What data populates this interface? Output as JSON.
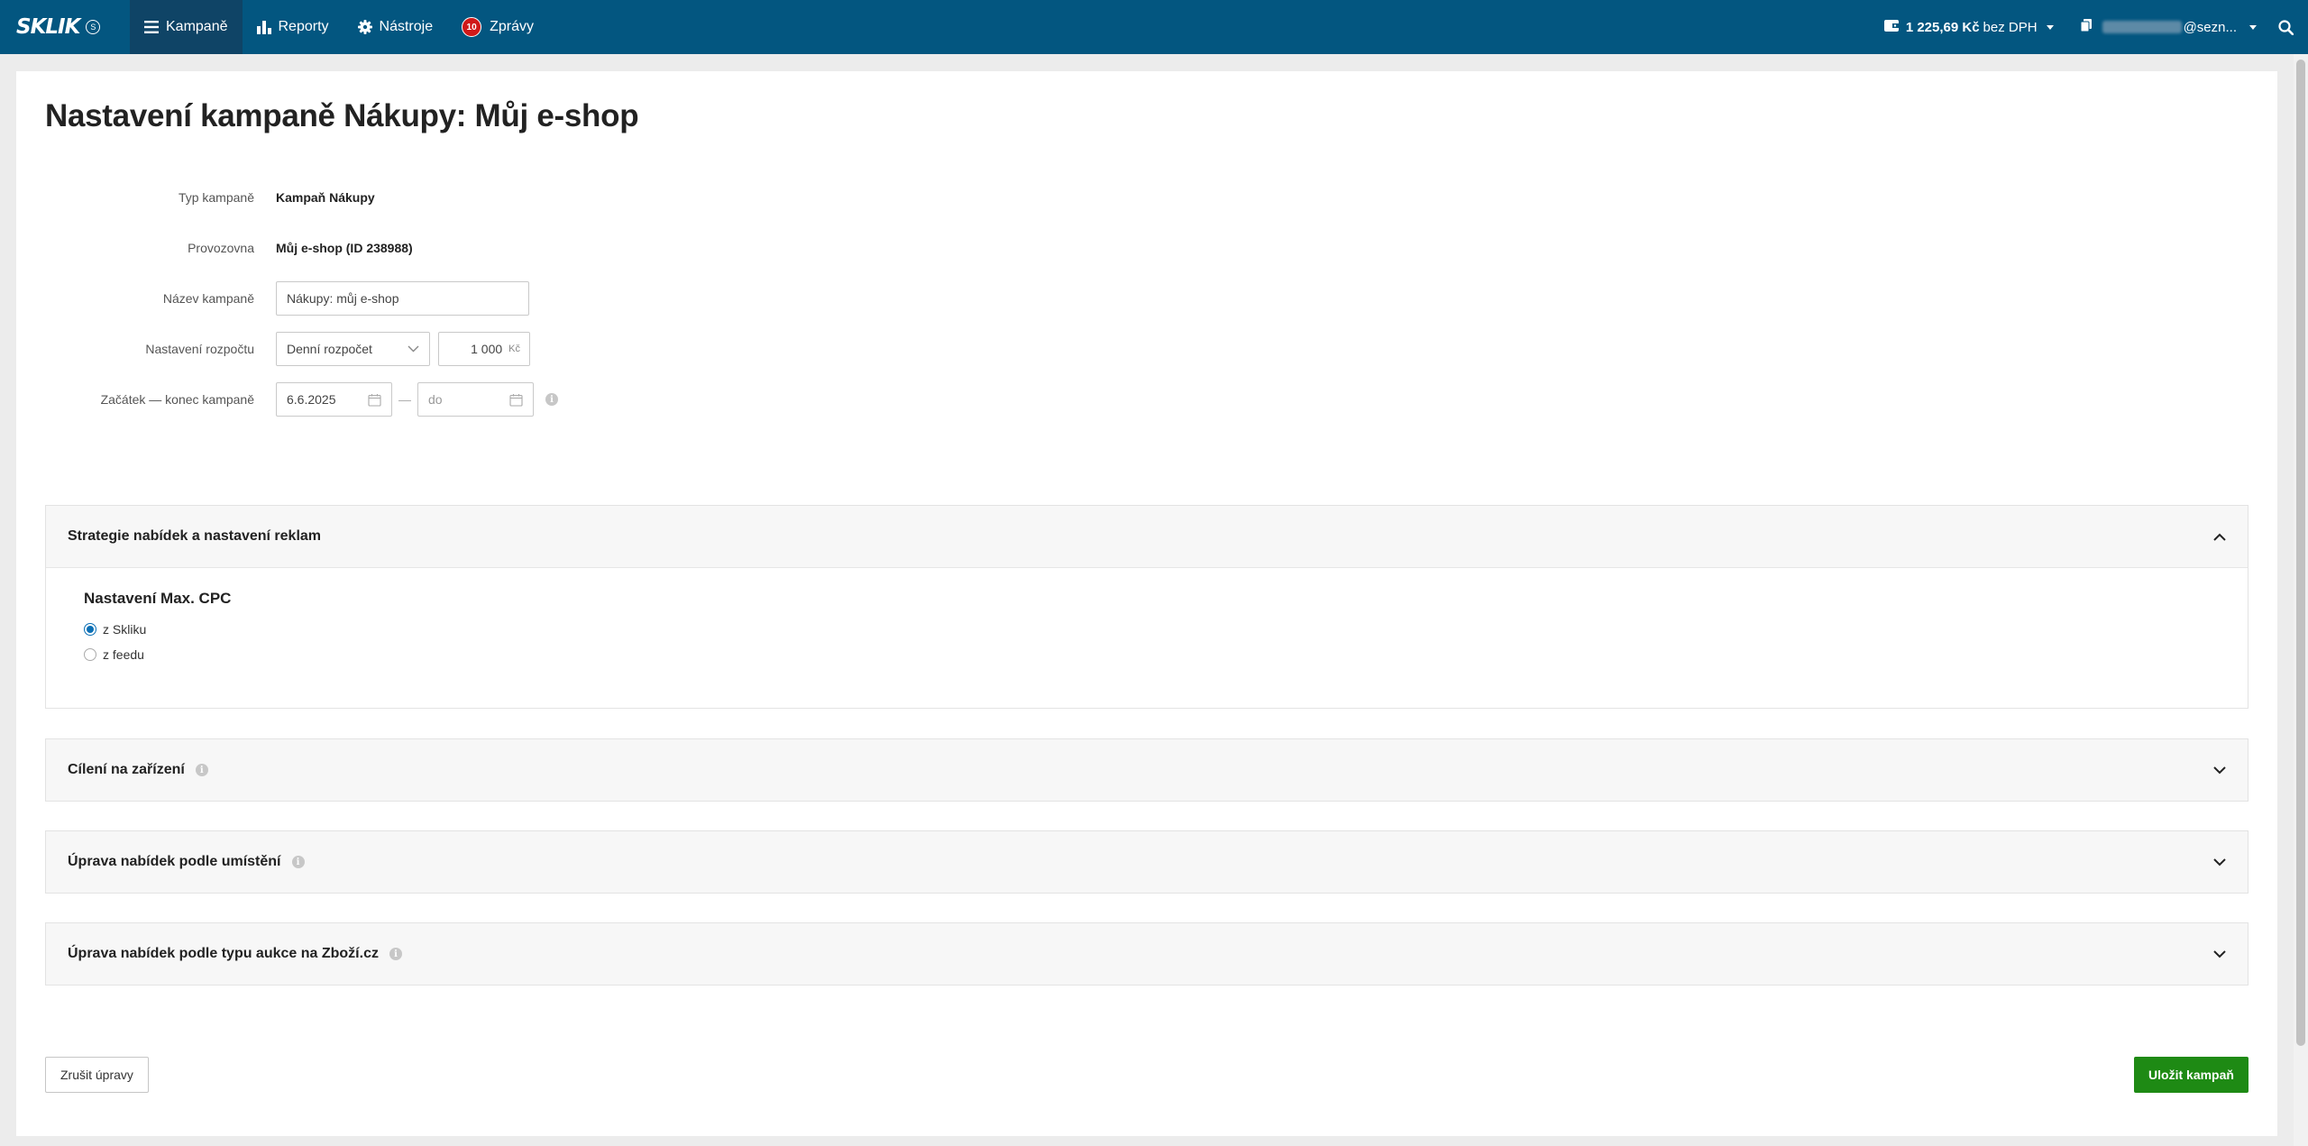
{
  "nav": {
    "logo": "SKLIK",
    "logo_badge": "S",
    "items": [
      {
        "label": "Kampaně",
        "icon": "menu-icon"
      },
      {
        "label": "Reporty",
        "icon": "bar-chart-icon"
      },
      {
        "label": "Nástroje",
        "icon": "gear-icon"
      },
      {
        "label": "Zprávy",
        "icon": "messages-badge",
        "badge": "10"
      }
    ],
    "credit_amount": "1 225,69 Kč",
    "credit_suffix": "bez DPH",
    "account_email": "@sezn...",
    "search_icon": "search-icon"
  },
  "page": {
    "title": "Nastavení kampaně Nákupy: Můj e-shop"
  },
  "form": {
    "campaign_type_label": "Typ kampaně",
    "campaign_type_value": "Kampaň Nákupy",
    "premise_label": "Provozovna",
    "premise_value": "Můj e-shop (ID 238988)",
    "name_label": "Název kampaně",
    "name_value": "Nákupy: můj e-shop",
    "budget_label": "Nastavení rozpočtu",
    "budget_type": "Denní rozpočet",
    "budget_amount": "1 000",
    "budget_currency": "Kč",
    "dates_label": "Začátek — konec kampaně",
    "start_date": "6.6.2025",
    "date_separator": "—",
    "end_placeholder": "do"
  },
  "sections": [
    {
      "title": "Strategie nabídek a nastavení reklam",
      "expanded": true
    },
    {
      "title": "Cílení na zařízení",
      "expanded": false
    },
    {
      "title": "Úprava nabídek podle umístění",
      "expanded": false
    },
    {
      "title": "Úprava nabídek podle typu aukce na Zboží.cz",
      "expanded": false
    }
  ],
  "cpc": {
    "title": "Nastavení Max. CPC",
    "options": [
      {
        "label": "z Skliku",
        "checked": true
      },
      {
        "label": "z feedu",
        "checked": false
      }
    ]
  },
  "footer": {
    "cancel_label": "Zrušit úpravy",
    "save_label": "Uložit kampaň"
  },
  "colors": {
    "topbar": "#035680",
    "active_nav": "#0f4466",
    "save_button": "#1e8a14",
    "badge": "#d01919"
  }
}
